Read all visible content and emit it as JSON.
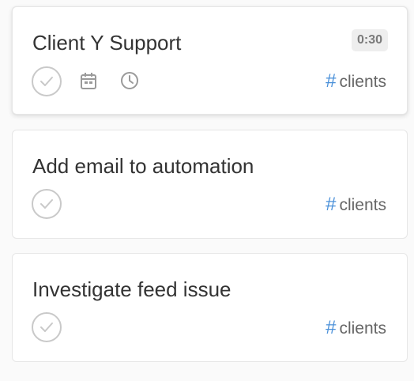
{
  "tasks": [
    {
      "title": "Client Y Support",
      "timer": "0:30",
      "tag_symbol": "#",
      "tag": "clients",
      "check_icon": "check-circle-icon",
      "calendar_icon": "calendar-icon",
      "clock_icon": "clock-icon"
    },
    {
      "title": "Add email to automation",
      "tag_symbol": "#",
      "tag": "clients",
      "check_icon": "check-circle-icon"
    },
    {
      "title": "Investigate feed issue",
      "tag_symbol": "#",
      "tag": "clients",
      "check_icon": "check-circle-icon"
    }
  ],
  "colors": {
    "tag_hash": "#4a90d9",
    "text": "#333333",
    "check": "#c9c9c9",
    "timer_bg": "#eeeeee"
  }
}
